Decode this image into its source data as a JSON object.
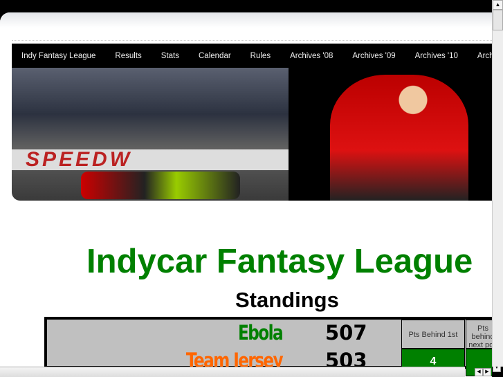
{
  "nav": {
    "items": [
      "Indy Fantasy League",
      "Results",
      "Stats",
      "Calendar",
      "Rules",
      "Archives '08",
      "Archives '09",
      "Archives '10",
      "Archives"
    ]
  },
  "banner": {
    "sign_text": "SPEEDW"
  },
  "page": {
    "title": "Indycar Fantasy League",
    "subtitle": "Standings"
  },
  "standings": {
    "headers": [
      "Pts Behind 1st",
      "Pts behind next pos"
    ],
    "rows": [
      {
        "team": "Ebola",
        "points": "507",
        "color": "#008000",
        "behind_first": ""
      },
      {
        "team": "Team Jersey",
        "points": "503",
        "color": "#ff6600",
        "behind_first": "4"
      }
    ]
  }
}
